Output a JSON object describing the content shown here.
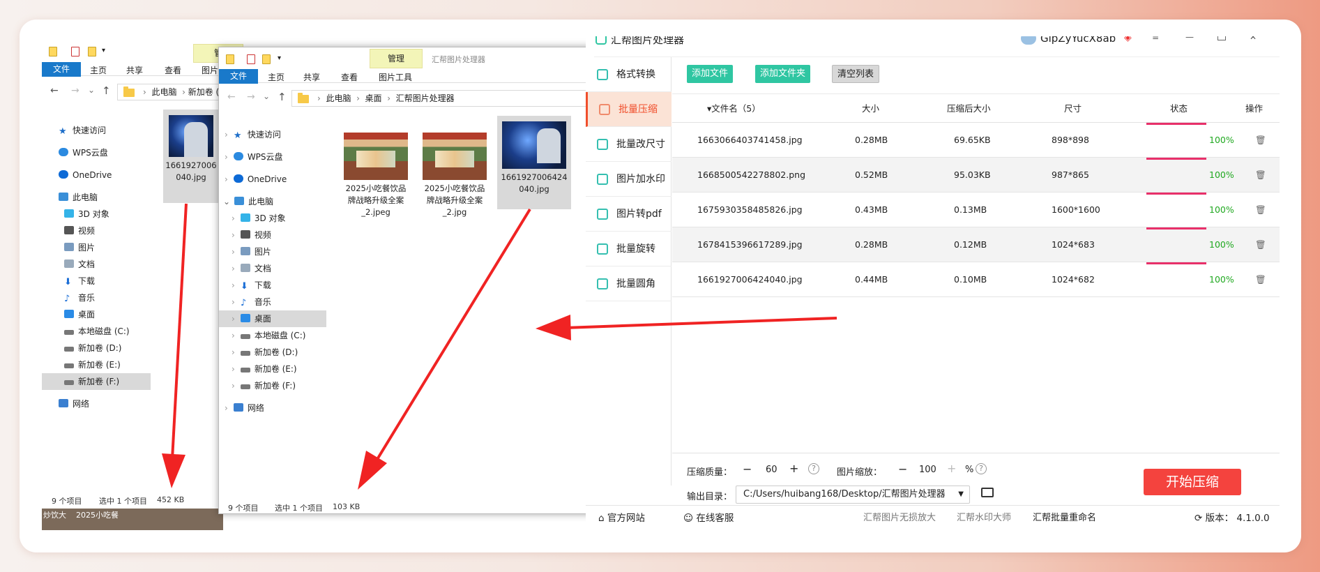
{
  "explorer_back": {
    "ribbon_tabs": [
      "文件",
      "主页",
      "共享",
      "查看"
    ],
    "context_tab": "管",
    "context_sub": "图片",
    "address_path": [
      "此电脑",
      "新加卷 ("
    ],
    "nav_items": [
      "快速访问",
      "WPS云盘",
      "OneDrive",
      "此电脑",
      "3D 对象",
      "视频",
      "图片",
      "文档",
      "下载",
      "音乐",
      "桌面",
      "本地磁盘 (C:)",
      "新加卷 (D:)",
      "新加卷 (E:)",
      "新加卷 (F:)",
      "网络"
    ],
    "file_name": "1661927006\n040.jpg",
    "status": [
      "9 个项目",
      "选中 1 个项目",
      "452 KB"
    ],
    "taskbar_text": [
      "炒饮大",
      "2025小吃餐"
    ]
  },
  "explorer_front": {
    "ribbon_tabs": [
      "文件",
      "主页",
      "共享",
      "查看"
    ],
    "context_tab": "管理",
    "context_sub": "图片工具",
    "window_title": "汇帮图片处理器",
    "address_path": [
      "此电脑",
      "桌面",
      "汇帮图片处理器"
    ],
    "nav_items": [
      "快速访问",
      "WPS云盘",
      "OneDrive",
      "此电脑",
      "3D 对象",
      "视频",
      "图片",
      "文档",
      "下载",
      "音乐",
      "桌面",
      "本地磁盘 (C:)",
      "新加卷 (D:)",
      "新加卷 (E:)",
      "新加卷 (F:)",
      "网络"
    ],
    "files": [
      "2025小吃餐饮品\n牌战略升级全案\n_2.jpeg",
      "2025小吃餐饮品\n牌战略升级全案\n_2.jpg",
      "1661927006424\n040.jpg"
    ],
    "status": [
      "9 个项目",
      "选中 1 个项目",
      "103 KB"
    ]
  },
  "app": {
    "title": "汇帮图片处理器",
    "user": "GlpZyYucX8ab",
    "sidebar": [
      "格式转换",
      "批量压缩",
      "批量改尺寸",
      "图片加水印",
      "图片转pdf",
      "批量旋转",
      "批量圆角"
    ],
    "toolbar": {
      "add_file": "添加文件",
      "add_folder": "添加文件夹",
      "clear": "清空列表"
    },
    "columns": [
      "▾文件名（5）",
      "大小",
      "压缩后大小",
      "尺寸",
      "状态",
      "操作"
    ],
    "rows": [
      {
        "name": "1663066403741458.jpg",
        "size": "0.28MB",
        "after": "69.65KB",
        "dim": "898*898",
        "status": "100%",
        "progress": 1.0
      },
      {
        "name": "1668500542278802.png",
        "size": "0.52MB",
        "after": "95.03KB",
        "dim": "987*865",
        "status": "100%",
        "progress": 1.0
      },
      {
        "name": "1675930358485826.jpg",
        "size": "0.43MB",
        "after": "0.13MB",
        "dim": "1600*1600",
        "status": "100%",
        "progress": 1.0
      },
      {
        "name": "1678415396617289.jpg",
        "size": "0.28MB",
        "after": "0.12MB",
        "dim": "1024*683",
        "status": "100%",
        "progress": 1.0
      },
      {
        "name": "1661927006424040.jpg",
        "size": "0.44MB",
        "after": "0.10MB",
        "dim": "1024*682",
        "status": "100%",
        "progress": 1.0
      }
    ],
    "quality_label": "压缩质量：",
    "quality_value": "60",
    "scale_label": "图片缩放：",
    "scale_value": "100",
    "scale_unit": "%",
    "output_label": "输出目录：",
    "output_path": "C:/Users/huibang168/Desktop/汇帮图片处理器",
    "start_button": "开始压缩",
    "footer": {
      "website": "官方网站",
      "support": "在线客服",
      "link1": "汇帮图片无损放大",
      "link2": "汇帮水印大师",
      "link3": "汇帮批量重命名",
      "version_label": "版本：",
      "version": "4.1.0.0"
    }
  },
  "colors": {
    "accent_red": "#f04e2b",
    "green_button": "#2fc6a2",
    "progress": "#e8306a",
    "percent": "#1fa81f",
    "start": "#f4433e"
  }
}
